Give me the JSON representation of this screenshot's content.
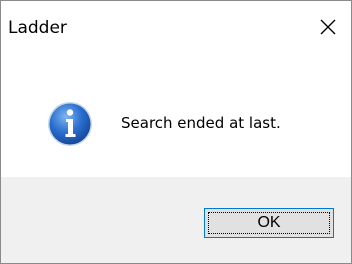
{
  "window": {
    "title": "Ladder",
    "close_icon": "close-icon"
  },
  "message": {
    "icon": "info-icon",
    "text": "Search ended at last."
  },
  "buttons": {
    "ok_label": "OK"
  },
  "colors": {
    "icon_blue": "#1d5fb8",
    "button_border": "#0078d7",
    "footer_bg": "#f0f0f0"
  }
}
